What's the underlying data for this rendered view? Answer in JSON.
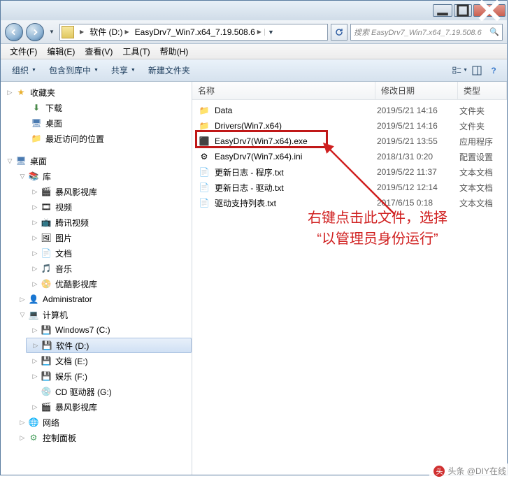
{
  "breadcrumb": {
    "seg1": "软件 (D:)",
    "seg2": "EasyDrv7_Win7.x64_7.19.508.6"
  },
  "search_placeholder": "搜索 EasyDrv7_Win7.x64_7.19.508.6",
  "menu": [
    "文件(F)",
    "编辑(E)",
    "查看(V)",
    "工具(T)",
    "帮助(H)"
  ],
  "toolbar": {
    "org": "组织",
    "inc": "包含到库中",
    "share": "共享",
    "new": "新建文件夹"
  },
  "columns": {
    "name": "名称",
    "date": "修改日期",
    "type": "类型"
  },
  "tree": {
    "fav": "收藏夹",
    "dl": "下载",
    "dt": "桌面",
    "recent": "最近访问的位置",
    "desktop": "桌面",
    "lib": "库",
    "bf": "暴风影视库",
    "vid": "视频",
    "tx": "腾讯视频",
    "pic": "图片",
    "doc": "文档",
    "mus": "音乐",
    "yk": "优酷影视库",
    "admin": "Administrator",
    "comp": "计算机",
    "c": "Windows7 (C:)",
    "d": "软件 (D:)",
    "e": "文档 (E:)",
    "f": "娱乐 (F:)",
    "cd": "CD 驱动器 (G:)",
    "bf2": "暴风影视库",
    "net": "网络",
    "ctrl": "控制面板"
  },
  "files": [
    {
      "icon": "folder",
      "name": "Data",
      "date": "2019/5/21 14:16",
      "type": "文件夹"
    },
    {
      "icon": "folder",
      "name": "Drivers(Win7.x64)",
      "date": "2019/5/21 14:16",
      "type": "文件夹"
    },
    {
      "icon": "exe",
      "name": "EasyDrv7(Win7.x64).exe",
      "date": "2019/5/21 13:55",
      "type": "应用程序"
    },
    {
      "icon": "ini",
      "name": "EasyDrv7(Win7.x64).ini",
      "date": "2018/1/31 0:20",
      "type": "配置设置"
    },
    {
      "icon": "txt",
      "name": "更新日志 - 程序.txt",
      "date": "2019/5/22 11:37",
      "type": "文本文档"
    },
    {
      "icon": "txt",
      "name": "更新日志 - 驱动.txt",
      "date": "2019/5/12 12:14",
      "type": "文本文档"
    },
    {
      "icon": "txt",
      "name": "驱动支持列表.txt",
      "date": "2017/6/15 0:18",
      "type": "文本文档"
    }
  ],
  "annotation": {
    "line1": "右键点击此文件，选择",
    "line2": "“以管理员身份运行”"
  },
  "watermark": "头条 @DIY在线"
}
